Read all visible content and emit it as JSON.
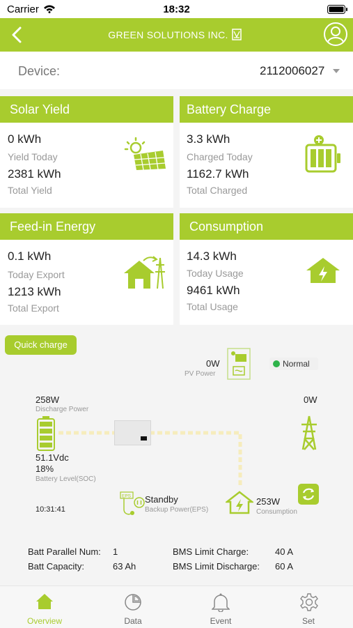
{
  "status_bar": {
    "carrier": "Carrier",
    "time": "18:32"
  },
  "header": {
    "title": "GREEN SOLUTIONS INC."
  },
  "device": {
    "label": "Device:",
    "value": "2112006027"
  },
  "cards": {
    "solar": {
      "title": "Solar Yield",
      "v1": "0 kWh",
      "l1": "Yield Today",
      "v2": "2381 kWh",
      "l2": "Total Yield"
    },
    "battery": {
      "title": "Battery Charge",
      "v1": "3.3 kWh",
      "l1": "Charged Today",
      "v2": "1162.7 kWh",
      "l2": "Total Charged"
    },
    "feedin": {
      "title": "Feed-in Energy",
      "v1": "0.1 kWh",
      "l1": "Today Export",
      "v2": "1213 kWh",
      "l2": "Total Export"
    },
    "consumption": {
      "title": "Consumption",
      "v1": "14.3 kWh",
      "l1": "Today Usage",
      "v2": "9461 kWh",
      "l2": "Total Usage"
    }
  },
  "quick_charge": "Quick charge",
  "flow": {
    "pv_value": "0W",
    "pv_label": "PV Power",
    "status": "Normal",
    "discharge_value": "258W",
    "discharge_label": "Discharge Power",
    "grid_value": "0W",
    "battery_voltage": "51.1Vdc",
    "battery_soc": "18%",
    "battery_label": "Battery Level(SOC)",
    "time": "10:31:41",
    "eps_status": "Standby",
    "eps_label": "Backup Power(EPS)",
    "load_value": "253W",
    "load_label": "Consumption"
  },
  "info": {
    "batt_parallel_label": "Batt Parallel Num:",
    "batt_parallel_value": "1",
    "batt_capacity_label": "Batt Capacity:",
    "batt_capacity_value": "63 Ah",
    "bms_charge_label": "BMS Limit Charge:",
    "bms_charge_value": "40 A",
    "bms_discharge_label": "BMS Limit Discharge:",
    "bms_discharge_value": "60 A"
  },
  "tabs": [
    {
      "label": "Overview",
      "icon": "home-icon",
      "active": true
    },
    {
      "label": "Data",
      "icon": "pie-chart-icon",
      "active": false
    },
    {
      "label": "Event",
      "icon": "bell-icon",
      "active": false
    },
    {
      "label": "Set",
      "icon": "gear-icon",
      "active": false
    }
  ],
  "colors": {
    "accent": "#a8cc2e",
    "flow_line": "#f6ecbc",
    "status_ok": "#2eb34a"
  }
}
